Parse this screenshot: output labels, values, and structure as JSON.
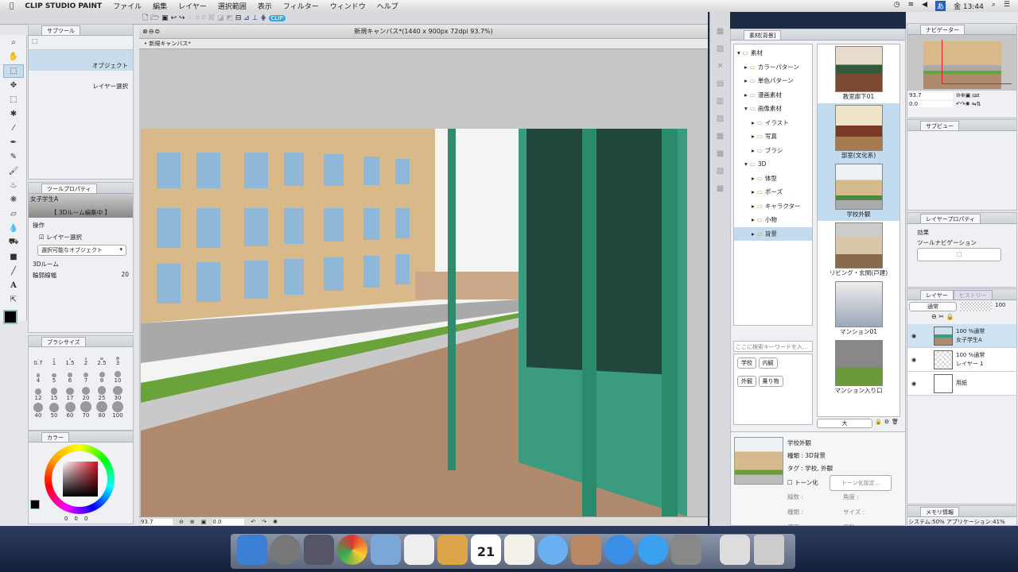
{
  "menubar": {
    "app": "CLIP STUDIO PAINT",
    "items": [
      "ファイル",
      "編集",
      "レイヤー",
      "選択範囲",
      "表示",
      "フィルター",
      "ウィンドウ",
      "ヘルプ"
    ],
    "clock": "金 13:44",
    "ime": "あ"
  },
  "subtool": {
    "tab": "サブツール",
    "items": [
      "オブジェクト",
      "レイヤー選択"
    ]
  },
  "toolprop": {
    "tab": "ツールプロパティ",
    "object_name": "女子学生A",
    "mode": "【 3Dルーム編集中 】",
    "section_op": "操作",
    "layer_select": "レイヤー選択",
    "select_target": "選択可能なオブジェクト",
    "section_3d": "3Dルーム",
    "outline_label": "輪郭線幅",
    "outline_value": "20"
  },
  "brushsize": {
    "tab": "ブラシサイズ",
    "sizes": [
      "0.7",
      "1",
      "1.5",
      "2",
      "2.5",
      "3",
      "4",
      "5",
      "6",
      "7",
      "8",
      "10",
      "12",
      "15",
      "17",
      "20",
      "25",
      "30",
      "40",
      "50",
      "60",
      "70",
      "80",
      "100"
    ]
  },
  "color": {
    "tab": "カラー",
    "values": [
      "0",
      "0",
      "0"
    ],
    "main_color": "#000000"
  },
  "canvas": {
    "window_title": "新規キャンバス*(1440 x 900px 72dpi 93.7%)",
    "doc_tab": "新規キャンバス*",
    "zoom": "93.7",
    "angle": "0.0"
  },
  "material": {
    "tab": "素材[背景]",
    "tree": [
      {
        "label": "素材",
        "level": 0,
        "open": true
      },
      {
        "label": "カラーパターン",
        "level": 1
      },
      {
        "label": "単色パターン",
        "level": 1
      },
      {
        "label": "漫画素材",
        "level": 1
      },
      {
        "label": "画像素材",
        "level": 1,
        "open": true
      },
      {
        "label": "イラスト",
        "level": 2
      },
      {
        "label": "写真",
        "level": 2
      },
      {
        "label": "ブラシ",
        "level": 2
      },
      {
        "label": "3D",
        "level": 1,
        "open": true
      },
      {
        "label": "体型",
        "level": 2
      },
      {
        "label": "ポーズ",
        "level": 2
      },
      {
        "label": "キャラクター",
        "level": 2
      },
      {
        "label": "小物",
        "level": 2
      },
      {
        "label": "背景",
        "level": 2,
        "selected": true
      }
    ],
    "search_placeholder": "ここに検索キーワードを入…",
    "tags": [
      "学校",
      "内観",
      "外観",
      "乗り物"
    ],
    "items": [
      "教室廊下01",
      "部室(文化系)",
      "学校外観",
      "リビング・玄関(戸建)",
      "マンション01",
      "マンション入り口"
    ],
    "size_select": "大",
    "detail": {
      "name": "学校外観",
      "type": "種類 : 3D背景",
      "tags": "タグ : 学校, 外観",
      "tone": "トーン化",
      "tone_settings": "トーン化設定...",
      "lines": "線数 :",
      "angle": "角度 :",
      "kind": "種類 :",
      "size": "サイズ :",
      "density": "濃度 :",
      "factor": "係数 :"
    }
  },
  "navigator": {
    "tab": "ナビゲーター",
    "zoom": "93.7",
    "angle": "0.0"
  },
  "subview": {
    "tab": "サブビュー"
  },
  "layerprop": {
    "tab": "レイヤープロパティ",
    "effect": "効果",
    "toolnav": "ツールナビゲーション"
  },
  "layers": {
    "tab": "レイヤー",
    "history_tab": "ヒストリー",
    "blend": "通常",
    "opacity": "100",
    "items": [
      {
        "mode": "100 %通常",
        "name": "女子学生A",
        "selected": true
      },
      {
        "mode": "100 %通常",
        "name": "レイヤー 1"
      },
      {
        "mode": "",
        "name": "用紙"
      }
    ]
  },
  "memory": {
    "tab": "メモリ情報",
    "text": "システム:50% アプリケーション:41%"
  },
  "dock": {
    "calendar_day": "21"
  }
}
